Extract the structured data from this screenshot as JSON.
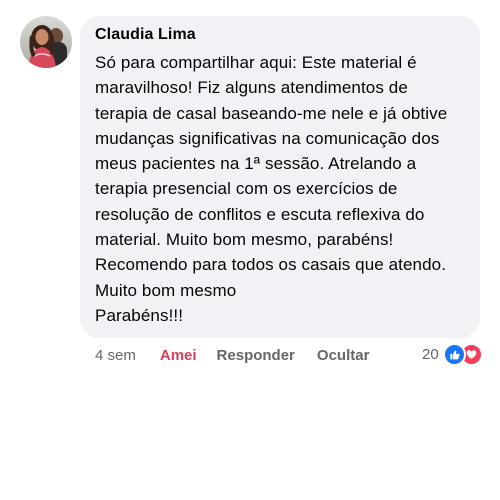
{
  "comment": {
    "author": "Claudia Lima",
    "text_lines": [
      "Só para compartilhar aqui: Este material é",
      "maravilhoso! Fiz alguns atendimentos de",
      "terapia de casal baseando-me nele e já obtive",
      "mudanças significativas na comunicação dos",
      "meus pacientes na 1ª sessão. Atrelando a",
      "terapia presencial com os exercícios de",
      "resolução de conflitos e escuta reflexiva do",
      "material. Muito bom mesmo, parabéns!",
      "Recomendo para todos os casais que atendo.",
      "Muito bom mesmo",
      "Parabéns!!!"
    ],
    "actions": {
      "time": "4 sem",
      "like_label": "Amei",
      "reply_label": "Responder",
      "hide_label": "Ocultar"
    },
    "reactions": {
      "count": "20",
      "icons": [
        "like-icon",
        "love-icon"
      ]
    }
  },
  "colors": {
    "bubble_bg": "#f0f2f5",
    "reacted_label": "#d33e5f",
    "meta_text": "#65676b",
    "like_blue": "#1877f2",
    "love_red": "#f33e58"
  }
}
